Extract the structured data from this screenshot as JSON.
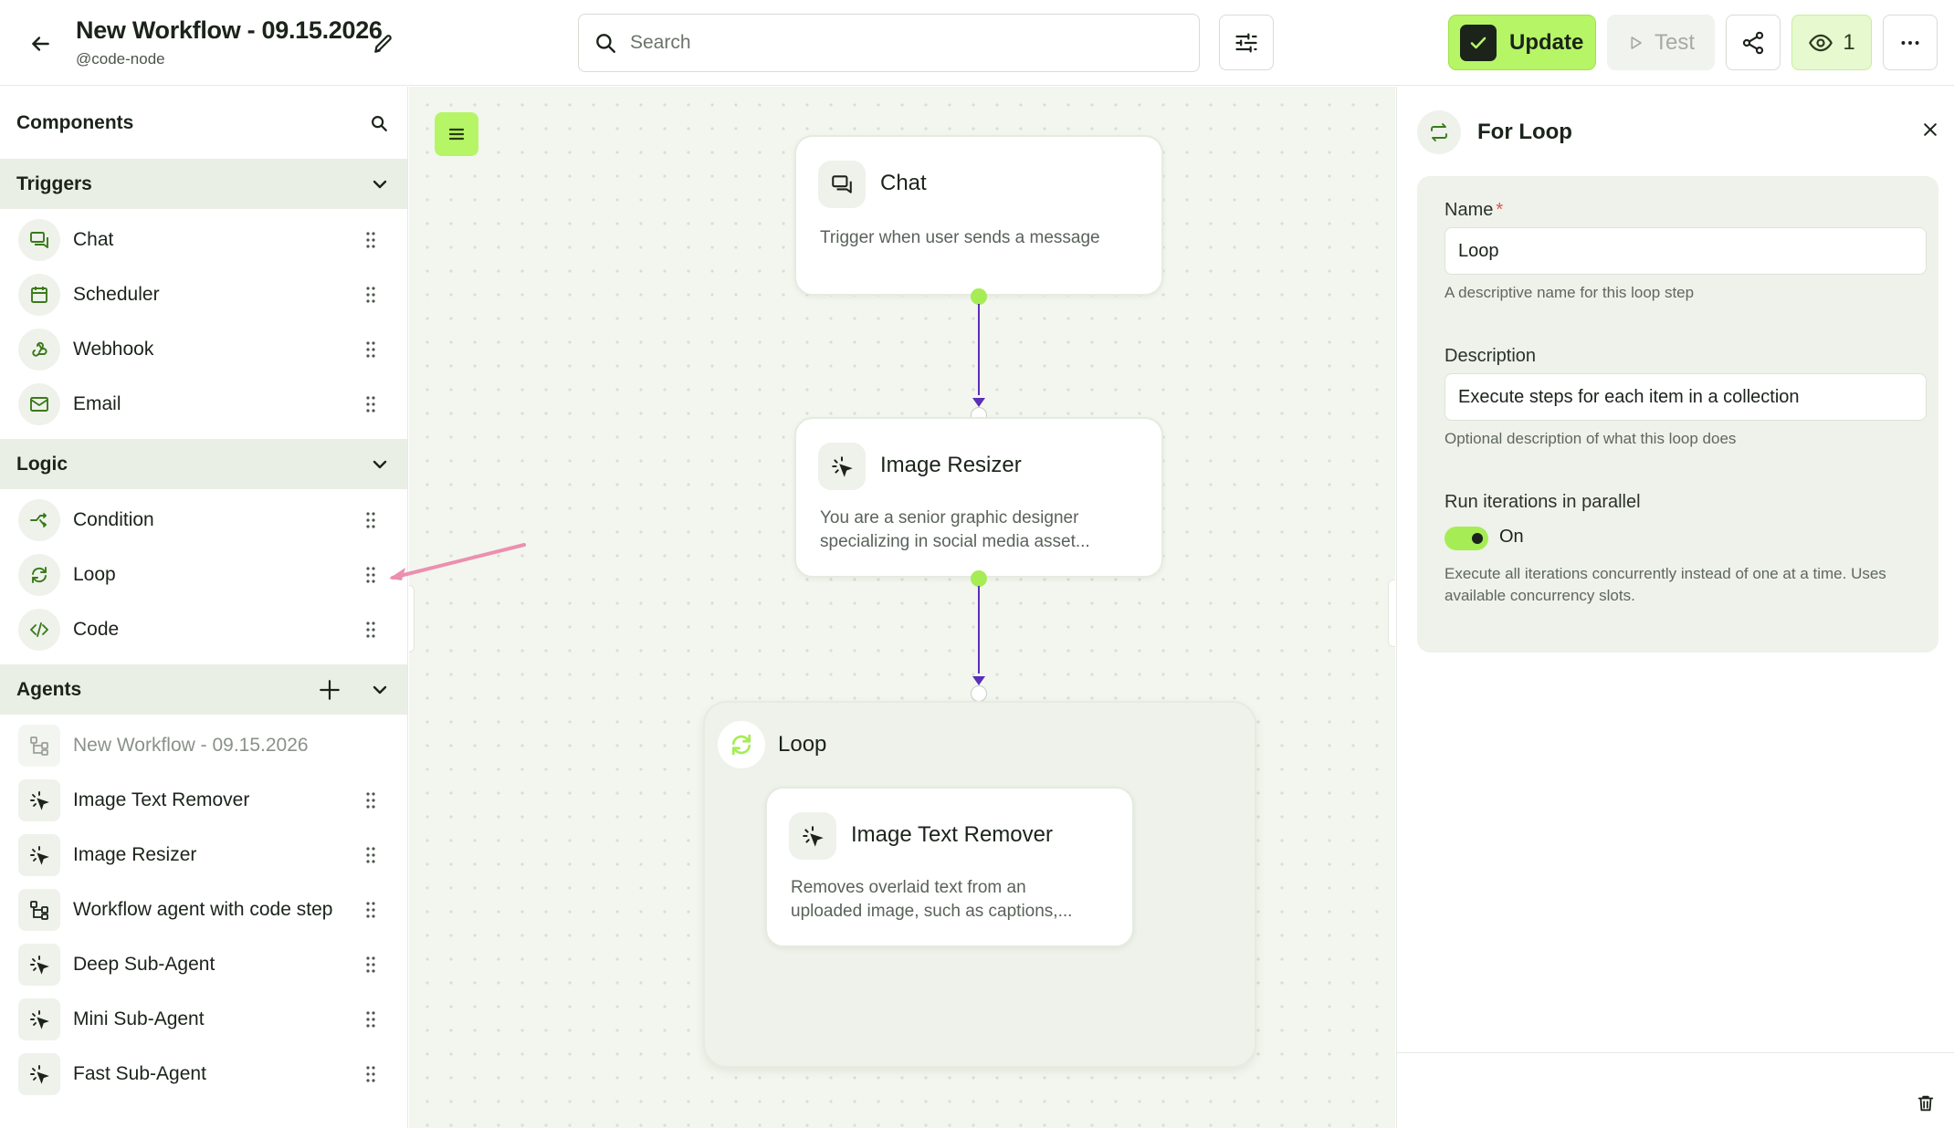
{
  "header": {
    "title": "New Workflow - 09.15.2026",
    "handle": "@code-node",
    "search_placeholder": "Search",
    "update_label": "Update",
    "test_label": "Test",
    "viewer_count": "1"
  },
  "sidebar": {
    "title": "Components",
    "sections": [
      {
        "title": "Triggers",
        "items": [
          {
            "label": "Chat",
            "icon": "chat-icon"
          },
          {
            "label": "Scheduler",
            "icon": "calendar-icon"
          },
          {
            "label": "Webhook",
            "icon": "webhook-icon"
          },
          {
            "label": "Email",
            "icon": "mail-icon"
          }
        ]
      },
      {
        "title": "Logic",
        "items": [
          {
            "label": "Condition",
            "icon": "branch-icon"
          },
          {
            "label": "Loop",
            "icon": "loop-icon"
          },
          {
            "label": "Code",
            "icon": "code-icon"
          }
        ]
      },
      {
        "title": "Agents",
        "items": [
          {
            "label": "New Workflow - 09.15.2026",
            "icon": "workflow-icon",
            "disabled": true
          },
          {
            "label": "Image Text Remover",
            "icon": "sparkle-cursor-icon"
          },
          {
            "label": "Image Resizer",
            "icon": "sparkle-cursor-icon"
          },
          {
            "label": "Workflow agent with code step",
            "icon": "workflow-icon"
          },
          {
            "label": "Deep Sub-Agent",
            "icon": "sparkle-cursor-icon"
          },
          {
            "label": "Mini Sub-Agent",
            "icon": "sparkle-cursor-icon"
          },
          {
            "label": "Fast Sub-Agent",
            "icon": "sparkle-cursor-icon"
          }
        ]
      }
    ]
  },
  "canvas": {
    "nodes": {
      "chat": {
        "title": "Chat",
        "description": "Trigger when user sends a message"
      },
      "resizer": {
        "title": "Image Resizer",
        "description": "You are a senior graphic designer specializing in social media asset..."
      },
      "loop": {
        "title": "Loop"
      },
      "remover": {
        "title": "Image Text Remover",
        "description": "Removes overlaid text from an uploaded image, such as captions,..."
      }
    }
  },
  "panel": {
    "title": "For Loop",
    "name_label": "Name",
    "name_required_mark": "*",
    "name_value": "Loop",
    "name_help": "A descriptive name for this loop step",
    "description_label": "Description",
    "description_value": "Execute steps for each item in a collection",
    "description_help": "Optional description of what this loop does",
    "parallel_label": "Run iterations in parallel",
    "parallel_state": "On",
    "parallel_help": "Execute all iterations concurrently instead of one at a time. Uses available concurrency slots."
  },
  "colors": {
    "accent": "#b6f566",
    "accent_border": "#9ee34a",
    "edge": "#5b2fb8",
    "annotation_arrow": "#ec8fb0"
  }
}
